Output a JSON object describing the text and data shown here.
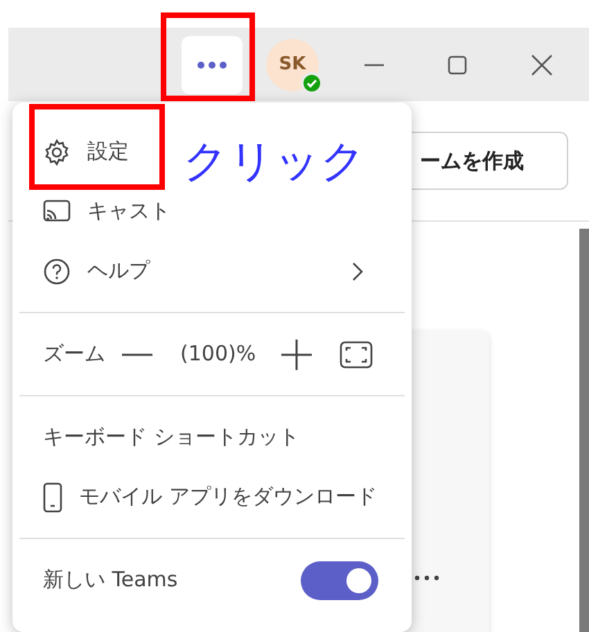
{
  "title_bar": {
    "avatar": {
      "initials": "SK",
      "status": {
        "color": "#13a10e"
      }
    }
  },
  "background": {
    "create_team_button": "ームを作成"
  },
  "menu": {
    "items": [
      {
        "kind": "item",
        "label": "設定",
        "submenu": false
      },
      {
        "kind": "item",
        "label": "キャスト",
        "submenu": false
      },
      {
        "kind": "item",
        "label": "ヘルプ",
        "submenu": true
      },
      {
        "kind": "divider"
      },
      {
        "kind": "zoom",
        "label": "ズーム",
        "value": "(100)%"
      },
      {
        "kind": "divider"
      },
      {
        "kind": "item",
        "label": "キーボード ショートカット",
        "submenu": false
      },
      {
        "kind": "item",
        "label": "モバイル アプリをダウンロード",
        "submenu": false
      },
      {
        "kind": "divider"
      },
      {
        "kind": "toggle",
        "label": "新しい Teams",
        "on": true
      }
    ]
  },
  "annotation": {
    "label": "クリック"
  }
}
